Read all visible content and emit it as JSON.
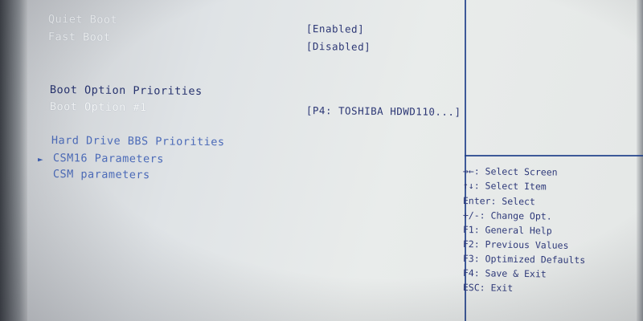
{
  "settings": {
    "quiet_boot": {
      "label": "Quiet Boot",
      "value": "[Enabled]"
    },
    "fast_boot": {
      "label": "Fast Boot",
      "value": "[Disabled]"
    },
    "boot_priorities_heading": "Boot Option Priorities",
    "boot_option_1": {
      "label": "Boot Option #1",
      "value": "[P4: TOSHIBA HDWD110...]"
    },
    "hdd_bbs": "Hard Drive BBS Priorities",
    "csm16": "CSM16 Parameters",
    "csm": "CSM parameters",
    "selection_marker": "►"
  },
  "help": [
    "→←: Select Screen",
    "↑↓: Select Item",
    "Enter: Select",
    "+/-: Change Opt.",
    "F1: General Help",
    "F2: Previous Values",
    "F3: Optimized Defaults",
    "F4: Save & Exit",
    "ESC: Exit"
  ],
  "colors": {
    "panel_bg": "#e4e7e6",
    "text_highlight": "#f4f6f6",
    "text_dark": "#27336e",
    "text_blue": "#4c6bb8",
    "divider": "#1f3f8a"
  }
}
